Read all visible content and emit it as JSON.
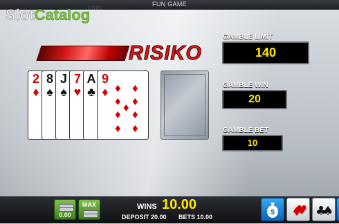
{
  "header": {
    "mode_label": "FUN GAME"
  },
  "watermark": {
    "part1": "Slot",
    "part2": "Catalog",
    "suffix": ".com"
  },
  "gamble": {
    "title": "RISIKO",
    "limit_label": "GAMBLE LIMIT",
    "limit_value": "140",
    "win_label": "GAMBLE WIN",
    "win_value": "20",
    "bet_label": "GAMBLE BET",
    "bet_value": "10"
  },
  "history_cards": [
    {
      "rank": "2",
      "suit": "♦",
      "color": "#d40000"
    },
    {
      "rank": "8",
      "suit": "♠",
      "color": "#111111"
    },
    {
      "rank": "J",
      "suit": "♠",
      "color": "#111111"
    },
    {
      "rank": "7",
      "suit": "♥",
      "color": "#d40000"
    },
    {
      "rank": "A",
      "suit": "♣",
      "color": "#111111"
    },
    {
      "rank": "9",
      "suit": "♦",
      "color": "#d40000"
    }
  ],
  "footer": {
    "wins_label": "WINS",
    "wins_value": "10.00",
    "deposit_label": "DEPOSIT 20.00",
    "bets_label": "BETS 10.00",
    "max_label": "MAX",
    "coin_label": "0.00"
  },
  "icons": [
    "money-bag-icon",
    "hearts-diamonds-icon",
    "spades-clubs-icon"
  ]
}
